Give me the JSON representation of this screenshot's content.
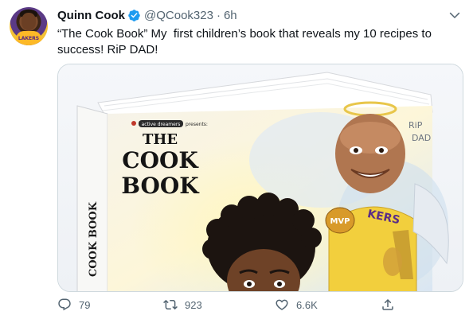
{
  "author": {
    "name": "Quinn Cook",
    "handle": "@QCook323",
    "separator": "·",
    "time": "6h",
    "verified": true,
    "avatar_jersey_text": "LAKERS"
  },
  "tweet": {
    "text": "“The Cook Book” My  first children’s book that reveals my 10 recipes to success! RiP DAD!"
  },
  "media": {
    "book_publisher": "active dreamers",
    "book_presents": "presents:",
    "book_title_line1": "THE",
    "book_title_line2": "COOK",
    "book_title_line3": "BOOK",
    "spine_text": "COOK BOOK",
    "rip_line1": "RiP",
    "rip_line2": "DAD",
    "mvp_text": "MVP",
    "jersey_text": "KERS"
  },
  "actions": {
    "reply_count": "79",
    "retweet_count": "923",
    "like_count": "6.6K"
  },
  "colors": {
    "text_primary": "#0f1419",
    "text_secondary": "#536471",
    "verified_blue": "#1d9bf0",
    "border": "#cfd9de"
  }
}
